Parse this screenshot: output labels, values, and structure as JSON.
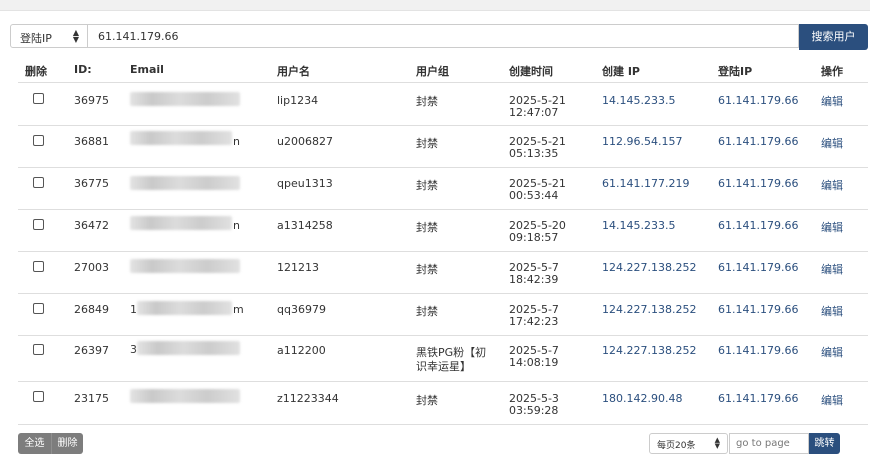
{
  "search": {
    "field_select": "登陆IP",
    "query_value": "61.141.179.66",
    "button": "搜索用户"
  },
  "table": {
    "headers": [
      "删除",
      "ID:",
      "Email",
      "用户名",
      "用户组",
      "创建时间",
      "创建 IP",
      "登陆IP",
      "操作"
    ],
    "rows": [
      {
        "id": "36975",
        "email_start": "",
        "email_end": "",
        "username": "lip1234",
        "group_l1": "封禁",
        "group_l2": "",
        "date": "2025-5-21",
        "time": "12:47:07",
        "create_ip": "14.145.233.5",
        "login_ip": "61.141.179.66",
        "action": "编辑"
      },
      {
        "id": "36881",
        "email_start": "",
        "email_end": "n",
        "username": "u2006827",
        "group_l1": "封禁",
        "group_l2": "",
        "date": "2025-5-21",
        "time": "05:13:35",
        "create_ip": "112.96.54.157",
        "login_ip": "61.141.179.66",
        "action": "编辑"
      },
      {
        "id": "36775",
        "email_start": "",
        "email_end": "",
        "username": "qpeu1313",
        "group_l1": "封禁",
        "group_l2": "",
        "date": "2025-5-21",
        "time": "00:53:44",
        "create_ip": "61.141.177.219",
        "login_ip": "61.141.179.66",
        "action": "编辑"
      },
      {
        "id": "36472",
        "email_start": "",
        "email_end": "n",
        "username": "a1314258",
        "group_l1": "封禁",
        "group_l2": "",
        "date": "2025-5-20",
        "time": "09:18:57",
        "create_ip": "14.145.233.5",
        "login_ip": "61.141.179.66",
        "action": "编辑"
      },
      {
        "id": "27003",
        "email_start": "",
        "email_end": "",
        "username": "121213",
        "group_l1": "封禁",
        "group_l2": "",
        "date": "2025-5-7",
        "time": "18:42:39",
        "create_ip": "124.227.138.252",
        "login_ip": "61.141.179.66",
        "action": "编辑"
      },
      {
        "id": "26849",
        "email_start": "1",
        "email_end": "m",
        "username": "qq36979",
        "group_l1": "封禁",
        "group_l2": "",
        "date": "2025-5-7",
        "time": "17:42:23",
        "create_ip": "124.227.138.252",
        "login_ip": "61.141.179.66",
        "action": "编辑"
      },
      {
        "id": "26397",
        "email_start": "3",
        "email_end": "",
        "username": "a112200",
        "group_l1": "黑铁PG粉【初",
        "group_l2": "识幸运星】",
        "date": "2025-5-7",
        "time": "14:08:19",
        "create_ip": "124.227.138.252",
        "login_ip": "61.141.179.66",
        "action": "编辑"
      },
      {
        "id": "23175",
        "email_start": "",
        "email_end": "",
        "username": "z11223344",
        "group_l1": "封禁",
        "group_l2": "",
        "date": "2025-5-3",
        "time": "03:59:28",
        "create_ip": "180.142.90.48",
        "login_ip": "61.141.179.66",
        "action": "编辑"
      }
    ]
  },
  "footer": {
    "select_all": "全选",
    "delete": "删除",
    "per_page": "每页20条",
    "goto_placeholder": "go to page",
    "jump": "跳转"
  },
  "colors": {
    "primary": "#2b4f7e",
    "secondary_button": "#7d7d7d"
  },
  "icons": {
    "select_arrow": "updown-caret-icon"
  }
}
